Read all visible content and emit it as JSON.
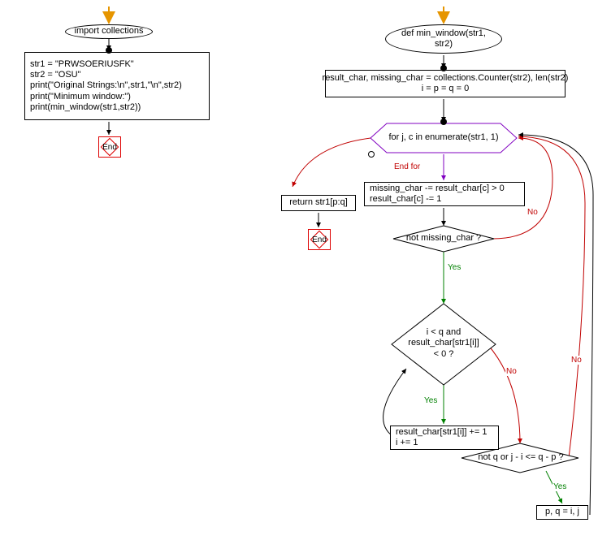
{
  "left": {
    "start_arrow_color": "#e69500",
    "import": "import collections",
    "code": "str1 = \"PRWSOERIUSFK\"\nstr2 = \"OSU\"\nprint(\"Original Strings:\\n\",str1,\"\\n\",str2)\nprint(\"Minimum window:\")\nprint(min_window(str1,str2))",
    "end": "End"
  },
  "right": {
    "start_arrow_color": "#e69500",
    "func_def": "def min_window(str1, str2)",
    "init": "result_char, missing_char = collections.Counter(str2), len(str2)\ni = p = q = 0",
    "loop": "for j, c in enumerate(str1, 1)",
    "end_for": "End for",
    "loop_body": "missing_char -= result_char[c] > 0\nresult_char[c] -= 1",
    "cond1": "not missing_char ?",
    "cond2": "i < q and\nresult_char[str1[i]]\n< 0 ?",
    "cond2_body": "result_char[str1[i]] += 1\ni += 1",
    "cond3": "not q or j - i <= q - p ?",
    "cond3_body": "p, q = i, j",
    "return": "return str1[p:q]",
    "end": "End",
    "labels": {
      "yes": "Yes",
      "no": "No"
    }
  },
  "chart_data": {
    "type": "flowchart",
    "subgraphs": [
      {
        "id": "left",
        "nodes": [
          {
            "id": "L_start",
            "shape": "arrow-in"
          },
          {
            "id": "L_import",
            "shape": "ellipse",
            "text": "import collections"
          },
          {
            "id": "L_code",
            "shape": "rect",
            "text": "str1 = \"PRWSOERIUSFK\"\nstr2 = \"OSU\"\nprint(\"Original Strings:\\n\",str1,\"\\n\",str2)\nprint(\"Minimum window:\")\nprint(min_window(str1,str2))"
          },
          {
            "id": "L_end",
            "shape": "end",
            "text": "End"
          }
        ],
        "edges": [
          {
            "from": "L_start",
            "to": "L_import"
          },
          {
            "from": "L_import",
            "to": "L_code"
          },
          {
            "from": "L_code",
            "to": "L_end"
          }
        ]
      },
      {
        "id": "right",
        "nodes": [
          {
            "id": "R_start",
            "shape": "arrow-in"
          },
          {
            "id": "R_def",
            "shape": "ellipse",
            "text": "def min_window(str1, str2)"
          },
          {
            "id": "R_init",
            "shape": "rect",
            "text": "result_char, missing_char = collections.Counter(str2), len(str2)\ni = p = q = 0"
          },
          {
            "id": "R_loop",
            "shape": "hexagon",
            "text": "for j, c in enumerate(str1, 1)"
          },
          {
            "id": "R_body",
            "shape": "rect",
            "text": "missing_char -= result_char[c] > 0\nresult_char[c] -= 1"
          },
          {
            "id": "R_cond1",
            "shape": "diamond",
            "text": "not missing_char ?"
          },
          {
            "id": "R_cond2",
            "shape": "diamond",
            "text": "i < q and result_char[str1[i]] < 0 ?"
          },
          {
            "id": "R_body2",
            "shape": "rect",
            "text": "result_char[str1[i]] += 1\ni += 1"
          },
          {
            "id": "R_cond3",
            "shape": "diamond",
            "text": "not q or j - i <= q - p ?"
          },
          {
            "id": "R_body3",
            "shape": "rect",
            "text": "p, q = i, j"
          },
          {
            "id": "R_return",
            "shape": "rect",
            "text": "return str1[p:q]"
          },
          {
            "id": "R_end",
            "shape": "end",
            "text": "End"
          }
        ],
        "edges": [
          {
            "from": "R_start",
            "to": "R_def"
          },
          {
            "from": "R_def",
            "to": "R_init"
          },
          {
            "from": "R_init",
            "to": "R_loop"
          },
          {
            "from": "R_loop",
            "to": "R_body",
            "label": ""
          },
          {
            "from": "R_loop",
            "to": "R_return",
            "label": "End for"
          },
          {
            "from": "R_body",
            "to": "R_cond1"
          },
          {
            "from": "R_cond1",
            "to": "R_cond2",
            "label": "Yes"
          },
          {
            "from": "R_cond1",
            "to": "R_loop",
            "label": "No"
          },
          {
            "from": "R_cond2",
            "to": "R_body2",
            "label": "Yes"
          },
          {
            "from": "R_body2",
            "to": "R_cond2"
          },
          {
            "from": "R_cond2",
            "to": "R_cond3",
            "label": "No"
          },
          {
            "from": "R_cond3",
            "to": "R_body3",
            "label": "Yes"
          },
          {
            "from": "R_cond3",
            "to": "R_loop",
            "label": "No"
          },
          {
            "from": "R_body3",
            "to": "R_loop"
          },
          {
            "from": "R_return",
            "to": "R_end"
          }
        ]
      }
    ]
  }
}
